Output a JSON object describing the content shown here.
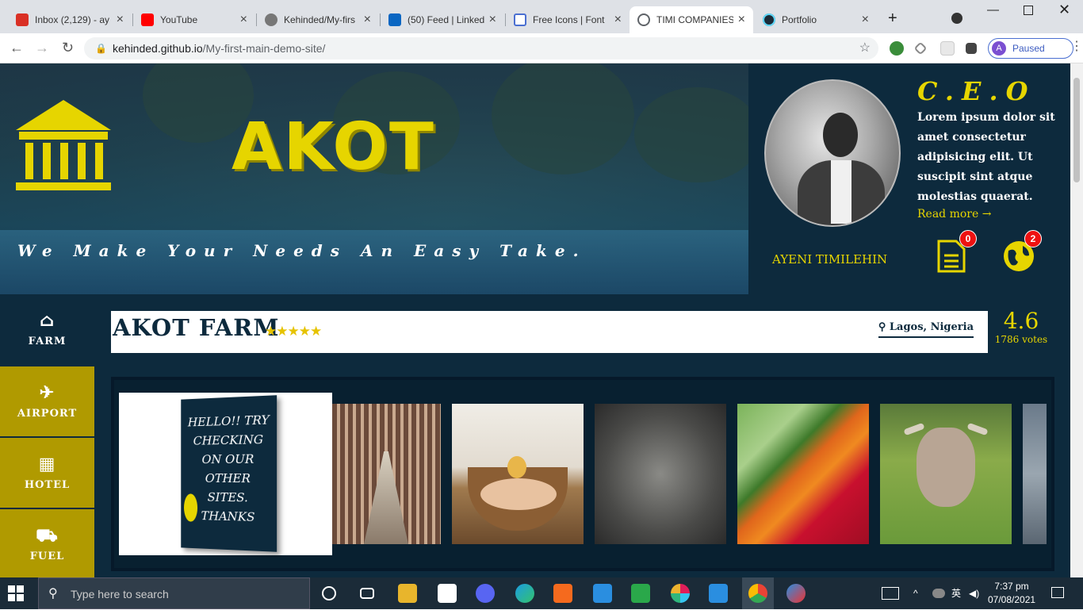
{
  "browser": {
    "tabs": [
      {
        "label": "Inbox (2,129) - ay",
        "icon": "gmail-icon",
        "color": "#d93025"
      },
      {
        "label": "YouTube",
        "icon": "youtube-icon",
        "color": "#ff0000"
      },
      {
        "label": "Kehinded/My-firs",
        "icon": "github-icon",
        "color": "#333333"
      },
      {
        "label": "(50) Feed | Linked",
        "icon": "linkedin-icon",
        "color": "#0a66c2"
      },
      {
        "label": "Free Icons | Font",
        "icon": "flag-icon",
        "color": "#4a6fd1"
      },
      {
        "label": "TIMI COMPANIES",
        "icon": "globe-icon",
        "color": "#5f6368"
      },
      {
        "label": "Portfolio",
        "icon": "react-icon",
        "color": "#1b2b38"
      }
    ],
    "new_tab_label": "+",
    "url_host": "kehinded.github.io",
    "url_path": "/My-first-main-demo-site/",
    "profile_initial": "A",
    "profile_status": "Paused"
  },
  "hero": {
    "brand": "AKOT",
    "slogan": "We Make Your Needs An Easy Take."
  },
  "ceo": {
    "title": "C.E.O",
    "bio": "Lorem ipsum dolor sit amet consectetur adipisicing elit. Ut suscipit sint atque molestias quaerat.",
    "read_more": "Read more →",
    "name": "AYENI TIMILEHIN",
    "notif_docs": "0",
    "notif_globe": "2"
  },
  "sidebar": {
    "items": [
      {
        "label": "FARM",
        "icon": "home-icon"
      },
      {
        "label": "AIRPORT",
        "icon": "plane-icon"
      },
      {
        "label": "HOTEL",
        "icon": "building-icon"
      },
      {
        "label": "FUEL",
        "icon": "truck-icon"
      }
    ]
  },
  "farm": {
    "name": "AKOT FARM",
    "stars": "★★★★★",
    "location": "Lagos, Nigeria",
    "rating": "4.6",
    "votes": "1786 votes"
  },
  "gallery": {
    "hello_text": "HELLO!! TRY CHECKING ON OUR OTHER SITES. THANKS"
  },
  "taskbar": {
    "search_placeholder": "Type here to search",
    "time": "7:37 pm",
    "date": "07/08/2021"
  },
  "colors": {
    "accent": "#e6d500",
    "navy": "#0d2a3d",
    "sidebar_yellow": "#b09a00"
  }
}
